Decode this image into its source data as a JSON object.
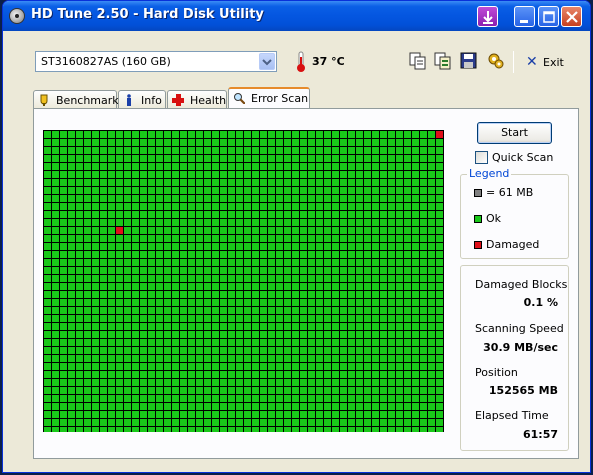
{
  "window": {
    "title": "HD Tune 2.50 - Hard Disk Utility"
  },
  "toolbar": {
    "drive": "ST3160827AS (160 GB)",
    "temperature": "37 °C",
    "exit_label": "Exit",
    "icons": [
      "copy-icon",
      "copy-info-icon",
      "save-icon",
      "options-icon"
    ]
  },
  "tabs": [
    {
      "label": "Benchmark",
      "icon": "benchmark-icon",
      "active": false
    },
    {
      "label": "Info",
      "icon": "info-icon",
      "active": false
    },
    {
      "label": "Health",
      "icon": "health-icon",
      "active": false
    },
    {
      "label": "Error Scan",
      "icon": "magnifier-icon",
      "active": true
    }
  ],
  "scan": {
    "start_label": "Start",
    "quick_scan_label": "Quick Scan",
    "quick_scan_checked": false,
    "grid_cols": 50,
    "grid_rows": 38,
    "damaged_cells": [
      [
        49,
        0
      ],
      [
        9,
        12
      ]
    ],
    "colors": {
      "ok": "#19c819",
      "damaged": "#e0101a",
      "unit": "#808080",
      "grid": "#000000"
    }
  },
  "legend": {
    "title": "Legend",
    "items": [
      {
        "label": "= 61 MB",
        "color": "#808080"
      },
      {
        "label": "Ok",
        "color": "#19c819"
      },
      {
        "label": "Damaged",
        "color": "#e0101a"
      }
    ]
  },
  "stats": {
    "damaged_blocks_label": "Damaged Blocks",
    "damaged_blocks_value": "0.1 %",
    "scanning_speed_label": "Scanning Speed",
    "scanning_speed_value": "30.9 MB/sec",
    "position_label": "Position",
    "position_value": "152565 MB",
    "elapsed_time_label": "Elapsed Time",
    "elapsed_time_value": "61:57"
  }
}
